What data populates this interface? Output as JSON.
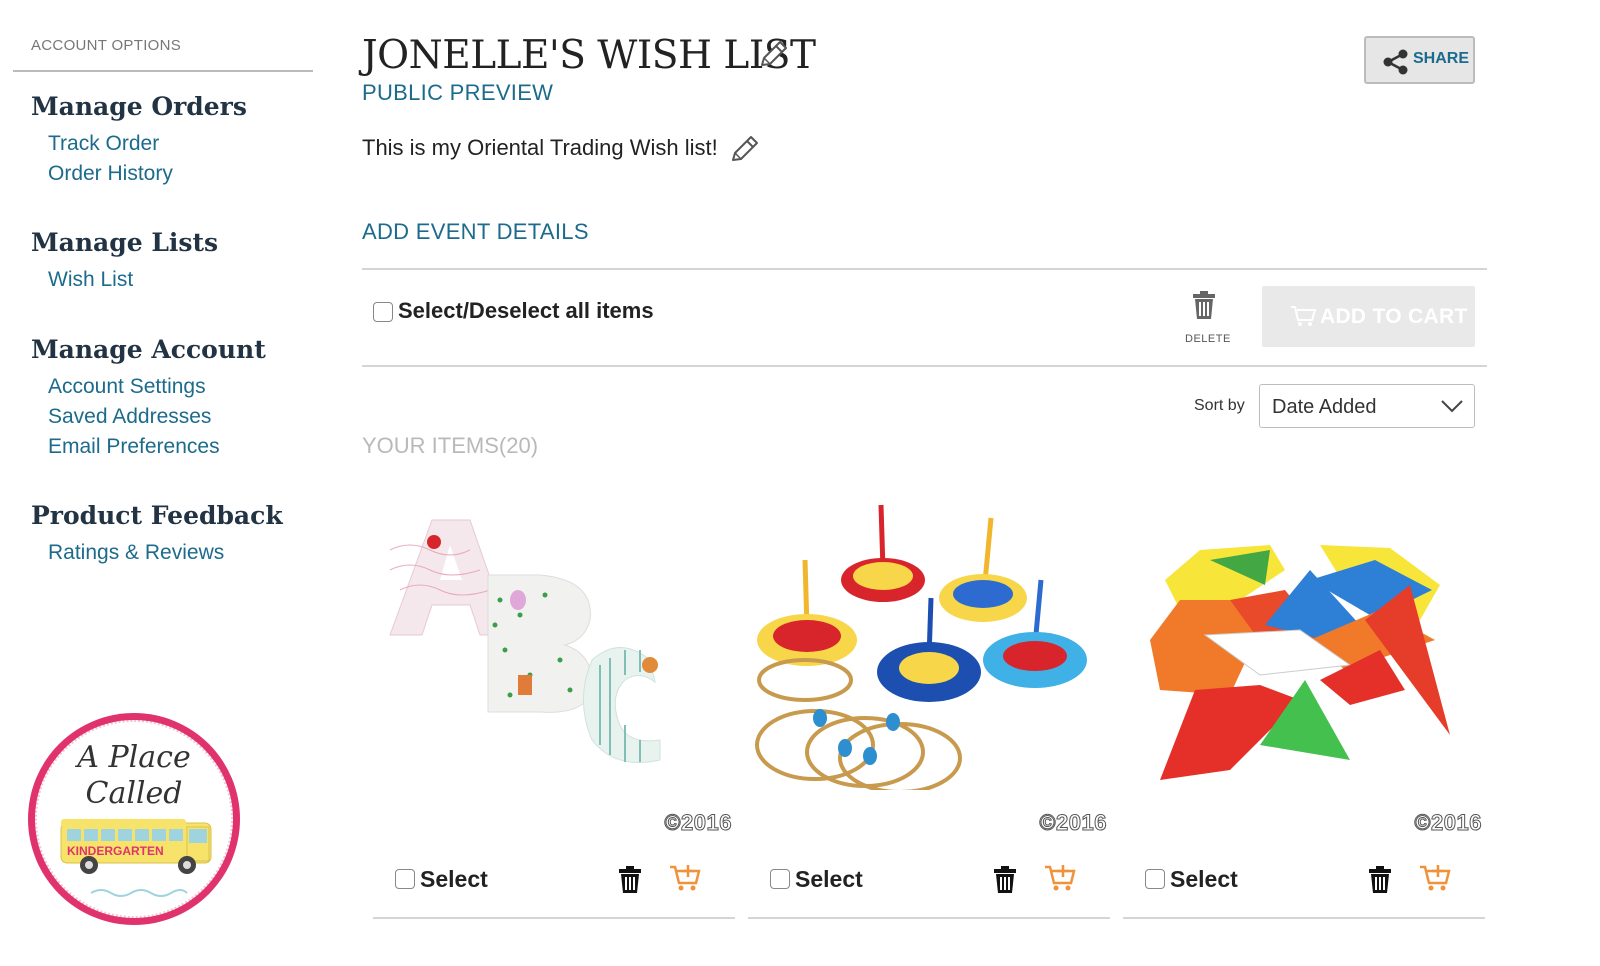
{
  "sidebar": {
    "heading": "ACCOUNT OPTIONS",
    "sections": [
      {
        "title": "Manage Orders",
        "links": [
          "Track Order",
          "Order History"
        ]
      },
      {
        "title": "Manage Lists",
        "links": [
          "Wish List"
        ]
      },
      {
        "title": "Manage Account",
        "links": [
          "Account Settings",
          "Saved Addresses",
          "Email Preferences"
        ]
      },
      {
        "title": "Product Feedback",
        "links": [
          "Ratings & Reviews"
        ]
      }
    ]
  },
  "logo": {
    "line1": "A Place",
    "line2": "Called",
    "bus_text": "KINDERGARTEN"
  },
  "header": {
    "title": "JONELLE'S WISH LIST",
    "public_preview": "PUBLIC PREVIEW",
    "share_label": "SHARE",
    "description": "This is my Oriental Trading Wish list!",
    "event_link": "ADD EVENT DETAILS"
  },
  "toolbar": {
    "select_all_label": "Select/Deselect all items",
    "delete_label": "DELETE",
    "add_to_cart_label": "ADD TO CART"
  },
  "sort": {
    "label": "Sort by",
    "value": "Date Added"
  },
  "items_count": "YOUR ITEMS(20)",
  "products": [
    {
      "select_label": "Select",
      "copyright": "©2016",
      "image_icon": "abc-letters-image"
    },
    {
      "select_label": "Select",
      "copyright": "©2016",
      "image_icon": "ring-toss-game-image"
    },
    {
      "select_label": "Select",
      "copyright": "©2016",
      "image_icon": "foam-tangram-shapes-image"
    }
  ],
  "colors": {
    "link": "#1c6b8c",
    "heading": "#223344",
    "cart_orange": "#f0923a",
    "logo_pink": "#e0336e",
    "bus_yellow": "#f7e36a"
  }
}
